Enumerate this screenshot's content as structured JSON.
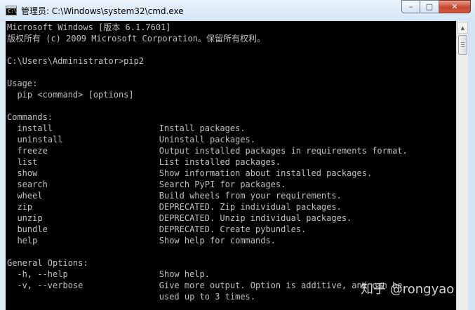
{
  "window": {
    "title": "管理员: C:\\Windows\\system32\\cmd.exe",
    "icon": "cmd-console-icon",
    "icon_text": "C:\\",
    "controls": {
      "minimize": "–",
      "maximize": "□",
      "close": "✕"
    }
  },
  "console": {
    "lines": [
      "Microsoft Windows [版本 6.1.7601]",
      "版权所有 (c) 2009 Microsoft Corporation。保留所有权利。",
      "",
      "C:\\Users\\Administrator>pip2",
      "",
      "Usage:",
      "  pip <command> [options]",
      "",
      "Commands:",
      "  install                     Install packages.",
      "  uninstall                   Uninstall packages.",
      "  freeze                      Output installed packages in requirements format.",
      "  list                        List installed packages.",
      "  show                        Show information about installed packages.",
      "  search                      Search PyPI for packages.",
      "  wheel                       Build wheels from your requirements.",
      "  zip                         DEPRECATED. Zip individual packages.",
      "  unzip                       DEPRECATED. Unzip individual packages.",
      "  bundle                      DEPRECATED. Create pybundles.",
      "  help                        Show help for commands.",
      "",
      "General Options:",
      "  -h, --help                  Show help.",
      "  -v, --verbose               Give more output. Option is additive, and can be",
      "                              used up to 3 times."
    ]
  },
  "scrollbar": {
    "up": "▲",
    "down": "▼"
  },
  "watermark": "知乎 @rongyao",
  "colors": {
    "console_bg": "#000000",
    "console_fg": "#c0c0c0",
    "frame": "#d3e5f5",
    "close": "#c7452f"
  }
}
